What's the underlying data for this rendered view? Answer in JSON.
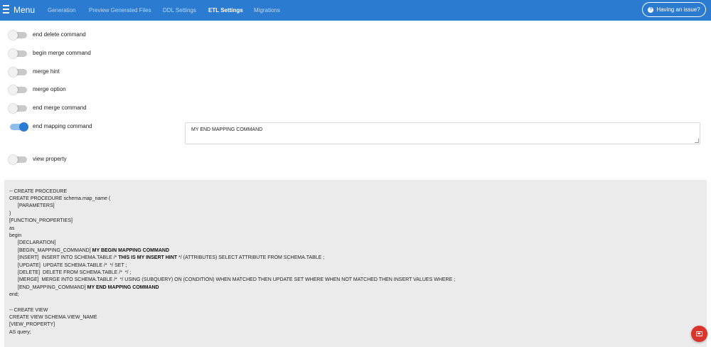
{
  "header": {
    "menu_label": "Menu",
    "nav": [
      "Generation",
      "Preview Generated Files",
      "DDL Settings",
      "ETL Settings",
      "Migrations"
    ],
    "active_nav": "ETL Settings",
    "issue_button": "Having an issue?",
    "accent_color": "#2b7bd0"
  },
  "settings": {
    "toggles": [
      {
        "label": "end delete command",
        "on": false
      },
      {
        "label": "begin merge command",
        "on": false
      },
      {
        "label": "merge hint",
        "on": false
      },
      {
        "label": "merge option",
        "on": false
      },
      {
        "label": "end merge command",
        "on": false
      },
      {
        "label": "end mapping command",
        "on": true
      },
      {
        "label": "view property",
        "on": false
      }
    ],
    "end_mapping_value": "MY END MAPPING COMMAND"
  },
  "code": {
    "l1": "-- CREATE PROCEDURE",
    "l2": "CREATE PROCEDURE schema.map_name (",
    "l3": "[PARAMETERS]",
    "l4": ")",
    "l5": "[FUNCTION_PROPERTIES]",
    "l6": "as",
    "l7": "begin",
    "l8": "[DECLARATION]",
    "l9a": "[BEGIN_MAPPING_COMMAND] ",
    "l9b": "MY BEGIN MAPPING COMMAND",
    "l10a": "[INSERT]  INSERT INTO SCHEMA.TABLE /* ",
    "l10b": "THIS IS MY INSERT HINT",
    "l10c": " */ (ATTRIBUTES) SELECT ATTRIBUTE FROM SCHEMA.TABLE ;",
    "l11": "[UPDATE]  UPDATE SCHEMA.TABLE /*  */ SET ;",
    "l12": "[DELETE]  DELETE FROM SCHEMA.TABLE /*  */ ;",
    "l13": "[MERGE]  MERGE INTO SCHEMA.TABLE /*  */ USING (SUBQUERY) ON (CONDITION) WHEN MATCHED THEN UPDATE SET WHERE WHEN NOT MATCHED THEN INSERT VALUES WHERE ;",
    "l14a": "[END_MAPPING_COMMAND] ",
    "l14b": "MY END MAPPING COMMAND",
    "l15": "end;",
    "l16": "-- CREATE VIEW",
    "l17": "CREATE VIEW SCHEMA.VIEW_NAME",
    "l18": "[VIEW_PROPERTY]",
    "l19": "AS query;"
  },
  "fab_icon": "message-icon"
}
